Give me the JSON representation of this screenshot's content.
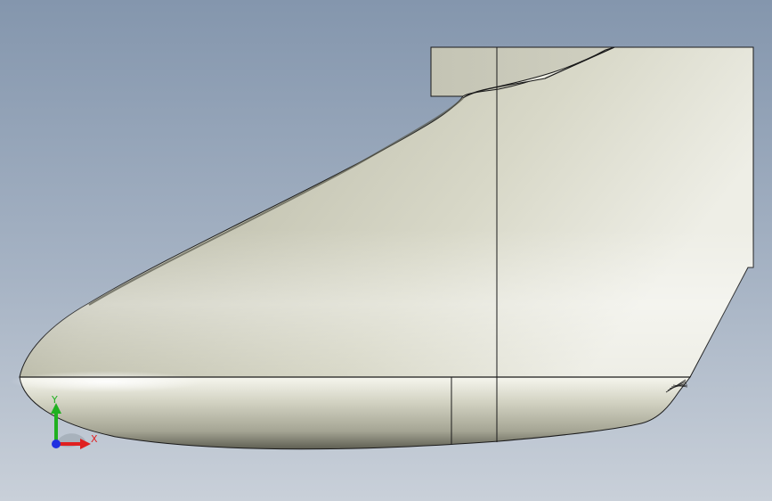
{
  "viewport": {
    "background_top": "#8496ad",
    "background_bottom": "#c9d0d9"
  },
  "model": {
    "surface_color": "#c8c8b6",
    "highlight_color": "#f4f4ec",
    "shadow_color": "#6f6f62",
    "edge_color": "#1a1a1a"
  },
  "triad": {
    "x_label": "X",
    "y_label": "Y",
    "x_color": "#e02020",
    "y_color": "#20b020",
    "z_color": "#2030e0"
  }
}
